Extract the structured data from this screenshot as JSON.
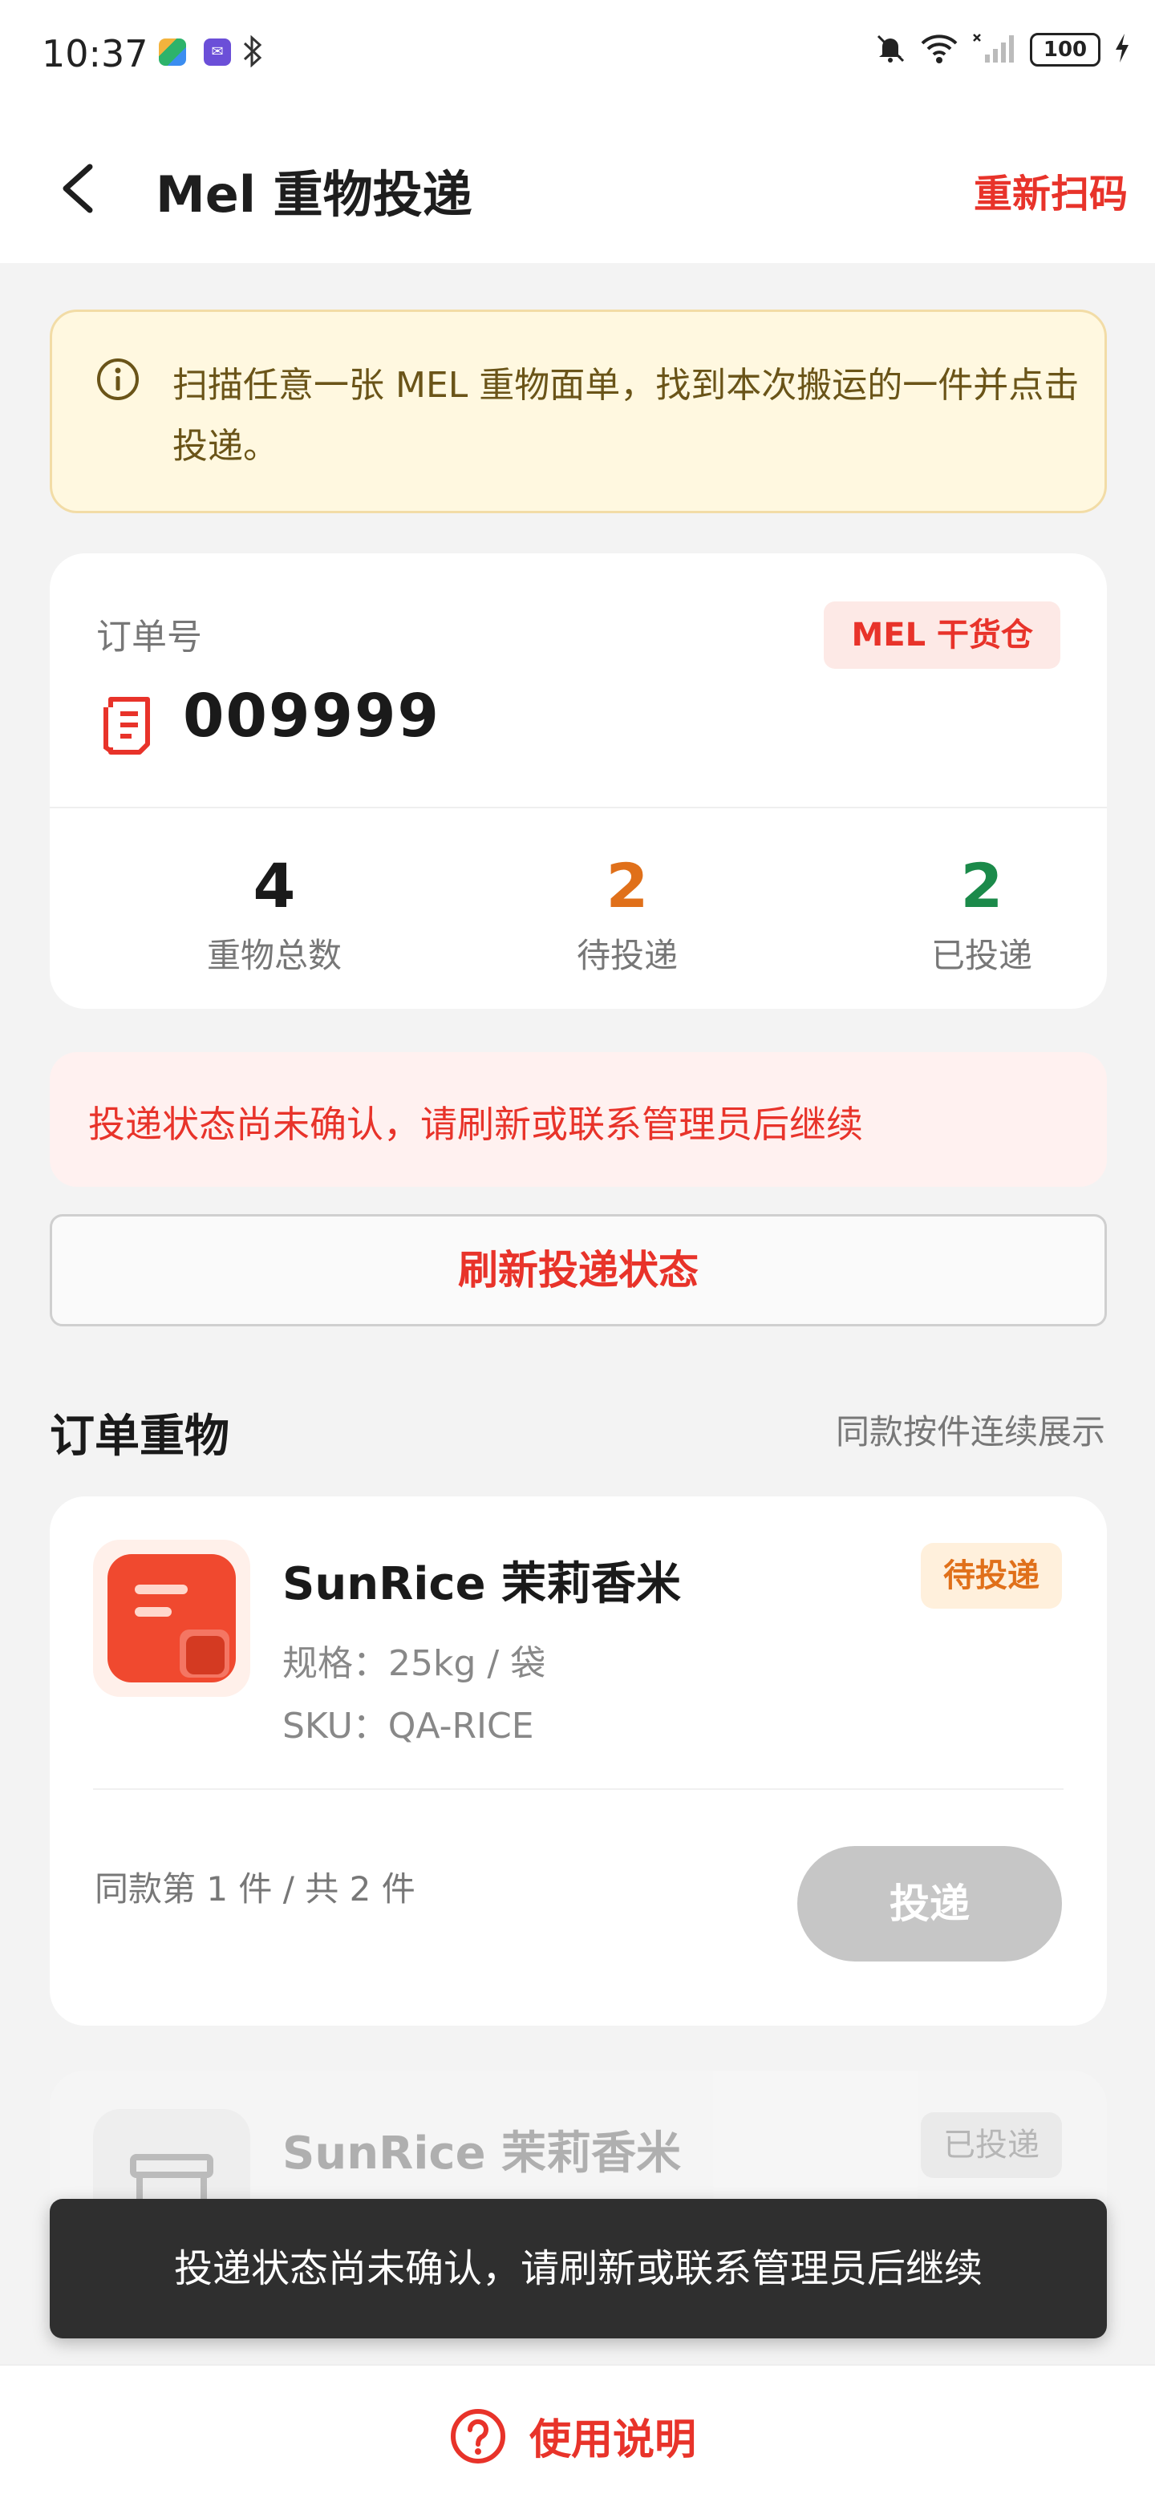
{
  "status_bar": {
    "time": "10:37",
    "battery": "100",
    "icons": [
      "app-icon",
      "app-icon",
      "bluetooth-icon",
      "mute-icon",
      "wifi-icon",
      "signal-icon",
      "battery-icon",
      "charging-icon"
    ]
  },
  "header": {
    "title": "Mel 重物投递",
    "action_label": "重新扫码"
  },
  "info_banner": {
    "icon": "info-icon",
    "text": "扫描任意一张 MEL 重物面单，找到本次搬运的一件并点击投递。"
  },
  "order": {
    "label": "订单号",
    "number": "009999",
    "warehouse_tag": "MEL 干货仓",
    "stats": [
      {
        "value": "4",
        "label": "重物总数",
        "color": "#1a1a1a"
      },
      {
        "value": "2",
        "label": "待投递",
        "color": "#e0701a"
      },
      {
        "value": "2",
        "label": "已投递",
        "color": "#1b8a4a"
      }
    ]
  },
  "error_banner": {
    "text": "投递状态尚未确认，请刷新或联系管理员后继续"
  },
  "refresh_button": {
    "label": "刷新投递状态"
  },
  "section": {
    "title": "订单重物",
    "note": "同款按件连续展示"
  },
  "items": [
    {
      "name": "SunRice 茉莉香米",
      "status": "待投递",
      "spec": "规格：25kg / 袋",
      "sku": "SKU：QA-RICE",
      "count": "同款第 1 件 / 共 2 件",
      "button": "投递"
    },
    {
      "name": "SunRice 茉莉香米",
      "status": "已投递"
    }
  ],
  "toast": {
    "text": "投递状态尚未确认，请刷新或联系管理员后继续"
  },
  "footer": {
    "help_label": "使用说明"
  },
  "colors": {
    "accent": "#e8332a",
    "pending": "#e0701a",
    "delivered": "#1b8a4a",
    "banner_bg": "#fff8e0"
  }
}
